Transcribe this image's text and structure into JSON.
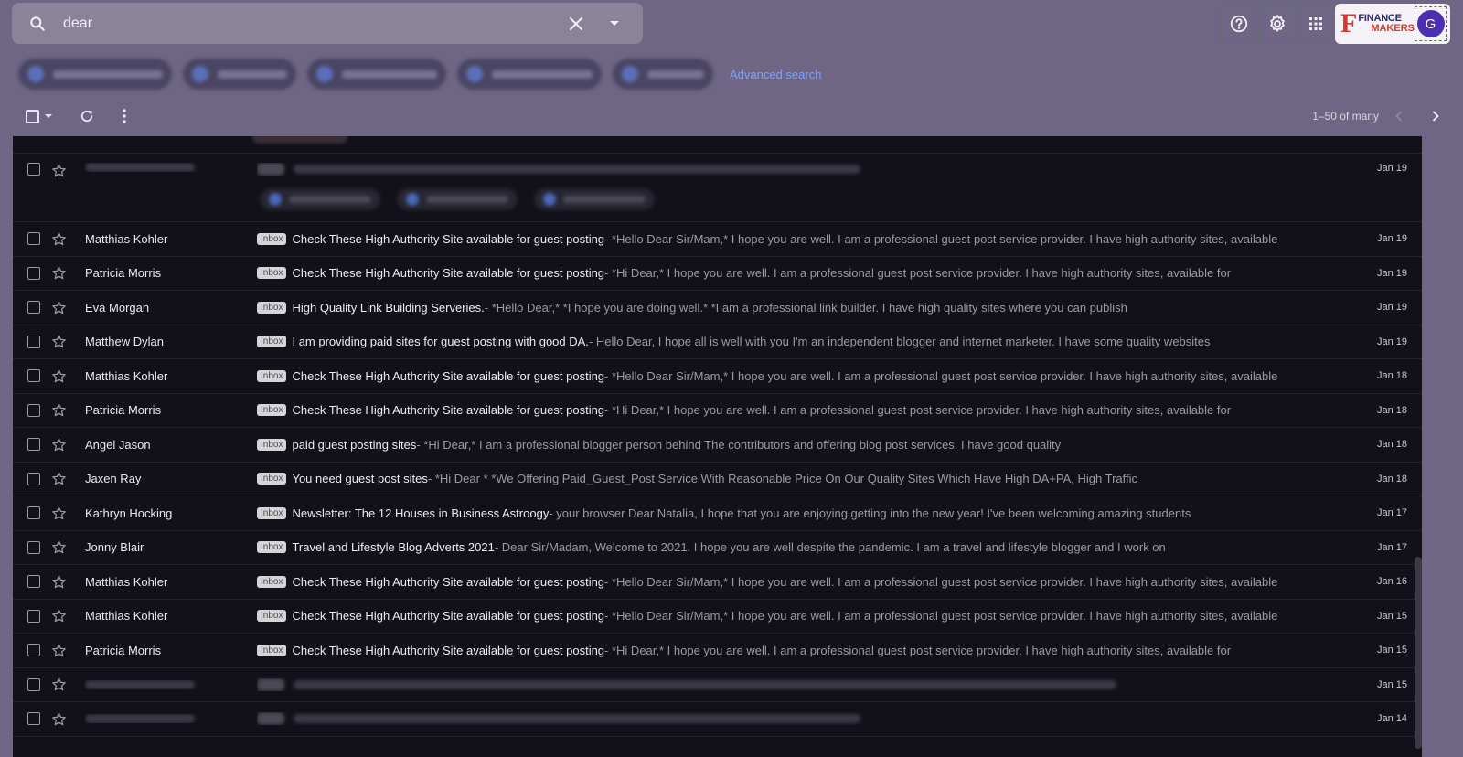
{
  "search": {
    "query": "dear"
  },
  "header": {
    "logo_mark": "F",
    "logo_line1": "FINANCE",
    "logo_line2": "MAKERS",
    "avatar_letter": "G"
  },
  "chips": {
    "advanced_search": "Advanced search"
  },
  "toolbar": {
    "pager_text": "1–50 of many"
  },
  "label": "Inbox",
  "emails": [
    {
      "sender": "",
      "subject": "",
      "snippet": "",
      "date": "Jan 19",
      "blurred": true,
      "tall": true
    },
    {
      "sender": "Matthias Kohler",
      "subject": "Check These High Authority Site available for guest posting",
      "snippet": " - *Hello Dear Sir/Mam,* I hope you are well. I am a professional guest post service provider. I have high authority sites, available",
      "date": "Jan 19"
    },
    {
      "sender": "Patricia Morris",
      "subject": "Check These High Authority Site available for guest posting",
      "snippet": " - *Hi Dear,* I hope you are well. I am a professional guest post service provider. I have high authority sites, available for",
      "date": "Jan 19"
    },
    {
      "sender": "Eva Morgan",
      "subject": "High Quality Link Building Serveries.",
      "snippet": " - *Hello Dear,* *I hope you are doing well.* *I am a professional link builder. I have high quality sites where you can publish",
      "date": "Jan 19"
    },
    {
      "sender": "Matthew Dylan",
      "subject": "I am providing paid sites for guest posting with good DA.",
      "snippet": " - Hello Dear, I hope all is well with you I'm an independent blogger and internet marketer. I have some quality websites",
      "date": "Jan 19"
    },
    {
      "sender": "Matthias Kohler",
      "subject": "Check These High Authority Site available for guest posting",
      "snippet": " - *Hello Dear Sir/Mam,* I hope you are well. I am a professional guest post service provider. I have high authority sites, available",
      "date": "Jan 18"
    },
    {
      "sender": "Patricia Morris",
      "subject": "Check These High Authority Site available for guest posting",
      "snippet": " - *Hi Dear,* I hope you are well. I am a professional guest post service provider. I have high authority sites, available for",
      "date": "Jan 18"
    },
    {
      "sender": "Angel Jason",
      "subject": "paid guest posting sites",
      "snippet": " - *Hi Dear,* I am a professional blogger person behind The contributors and offering blog post services. I have good quality",
      "date": "Jan 18"
    },
    {
      "sender": "Jaxen Ray",
      "subject": "You need guest post sites",
      "snippet": " - *Hi Dear * *We Offering Paid_Guest_Post Service With Reasonable Price On Our Quality Sites Which Have High DA+PA, High Traffic",
      "date": "Jan 18"
    },
    {
      "sender": "Kathryn Hocking",
      "subject": "Newsletter: The 12 Houses in Business Astroogy",
      "snippet": " - your browser Dear Natalia, I hope that you are enjoying getting into the new year! I've been welcoming amazing students",
      "date": "Jan 17"
    },
    {
      "sender": "Jonny Blair",
      "subject": "Travel and Lifestyle Blog Adverts 2021",
      "snippet": " - Dear Sir/Madam, Welcome to 2021. I hope you are well despite the pandemic. I am a travel and lifestyle blogger and I work on",
      "date": "Jan 17"
    },
    {
      "sender": "Matthias Kohler",
      "subject": "Check These High Authority Site available for guest posting",
      "snippet": " - *Hello Dear Sir/Mam,* I hope you are well. I am a professional guest post service provider. I have high authority sites, available",
      "date": "Jan 16"
    },
    {
      "sender": "Matthias Kohler",
      "subject": "Check These High Authority Site available for guest posting",
      "snippet": " - *Hello Dear Sir/Mam,* I hope you are well. I am a professional guest post service provider. I have high authority sites, available",
      "date": "Jan 15"
    },
    {
      "sender": "Patricia Morris",
      "subject": "Check These High Authority Site available for guest posting",
      "snippet": " - *Hi Dear,* I hope you are well. I am a professional guest post service provider. I have high authority sites, available for",
      "date": "Jan 15"
    },
    {
      "sender": "",
      "subject": "",
      "snippet": "",
      "date": "Jan 15",
      "blurred": true
    },
    {
      "sender": "",
      "subject": "",
      "snippet": "",
      "date": "Jan 14",
      "blurred": true
    }
  ]
}
